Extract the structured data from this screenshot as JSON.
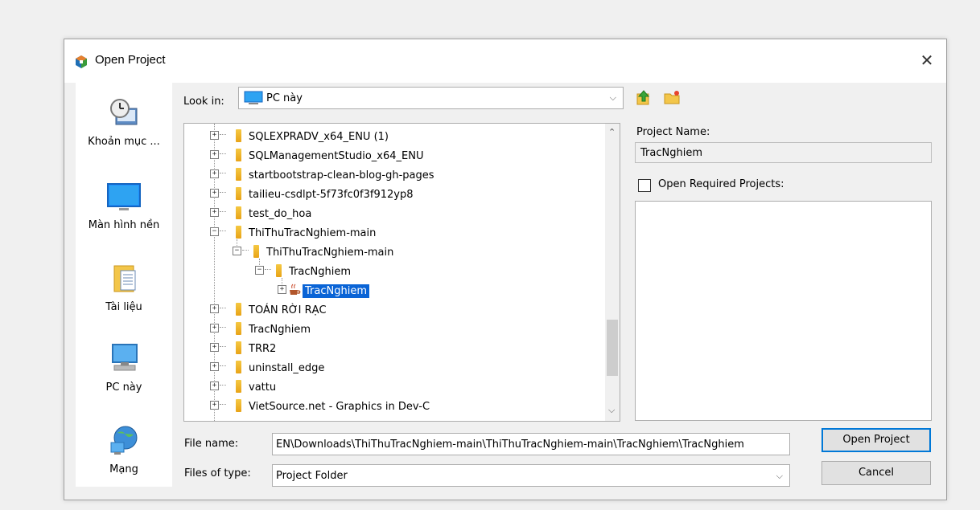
{
  "window": {
    "title": "Open Project",
    "close_glyph": "✕"
  },
  "places": [
    {
      "label": "Khoản mục ...",
      "icon": "recent-items-icon"
    },
    {
      "label": "Màn hình nền",
      "icon": "desktop-icon"
    },
    {
      "label": "Tài liệu",
      "icon": "documents-icon"
    },
    {
      "label": "PC này",
      "icon": "this-pc-icon"
    },
    {
      "label": "Mạng",
      "icon": "network-icon"
    }
  ],
  "look_in": {
    "label": "Look in:",
    "value": "PC này"
  },
  "tree": {
    "items": [
      {
        "label": "SQLEXPRADV_x64_ENU (1)",
        "expander": "+"
      },
      {
        "label": "SQLManagementStudio_x64_ENU",
        "expander": "+"
      },
      {
        "label": "startbootstrap-clean-blog-gh-pages",
        "expander": "+"
      },
      {
        "label": "tailieu-csdlpt-5f73fc0f3f912yp8",
        "expander": "+"
      },
      {
        "label": "test_do_hoa",
        "expander": "+"
      },
      {
        "label": "ThiThuTracNghiem-main",
        "expander": "−"
      },
      {
        "label": "ThiThuTracNghiem-main",
        "expander": "−"
      },
      {
        "label": "TracNghiem",
        "expander": "−"
      },
      {
        "label": "TracNghiem",
        "expander": "+",
        "selected": true
      },
      {
        "label": "TOÁN RỜI RẠC",
        "expander": "+"
      },
      {
        "label": "TracNghiem",
        "expander": "+"
      },
      {
        "label": "TRR2",
        "expander": "+"
      },
      {
        "label": "uninstall_edge",
        "expander": "+"
      },
      {
        "label": "vattu",
        "expander": "+"
      },
      {
        "label": "VietSource.net - Graphics in Dev-C",
        "expander": "+"
      }
    ]
  },
  "project_name": {
    "label": "Project Name:",
    "value": "TracNghiem"
  },
  "open_required": {
    "label": "Open Required Projects:",
    "checked": false
  },
  "file_name": {
    "label": "File name:",
    "value": "EN\\Downloads\\ThiThuTracNghiem-main\\ThiThuTracNghiem-main\\TracNghiem\\TracNghiem"
  },
  "files_of_type": {
    "label": "Files of type:",
    "value": "Project Folder"
  },
  "buttons": {
    "open": "Open Project",
    "cancel": "Cancel"
  },
  "colors": {
    "selection": "#0a64d6",
    "primary_border": "#0078d7",
    "folder": "#f5c842"
  }
}
